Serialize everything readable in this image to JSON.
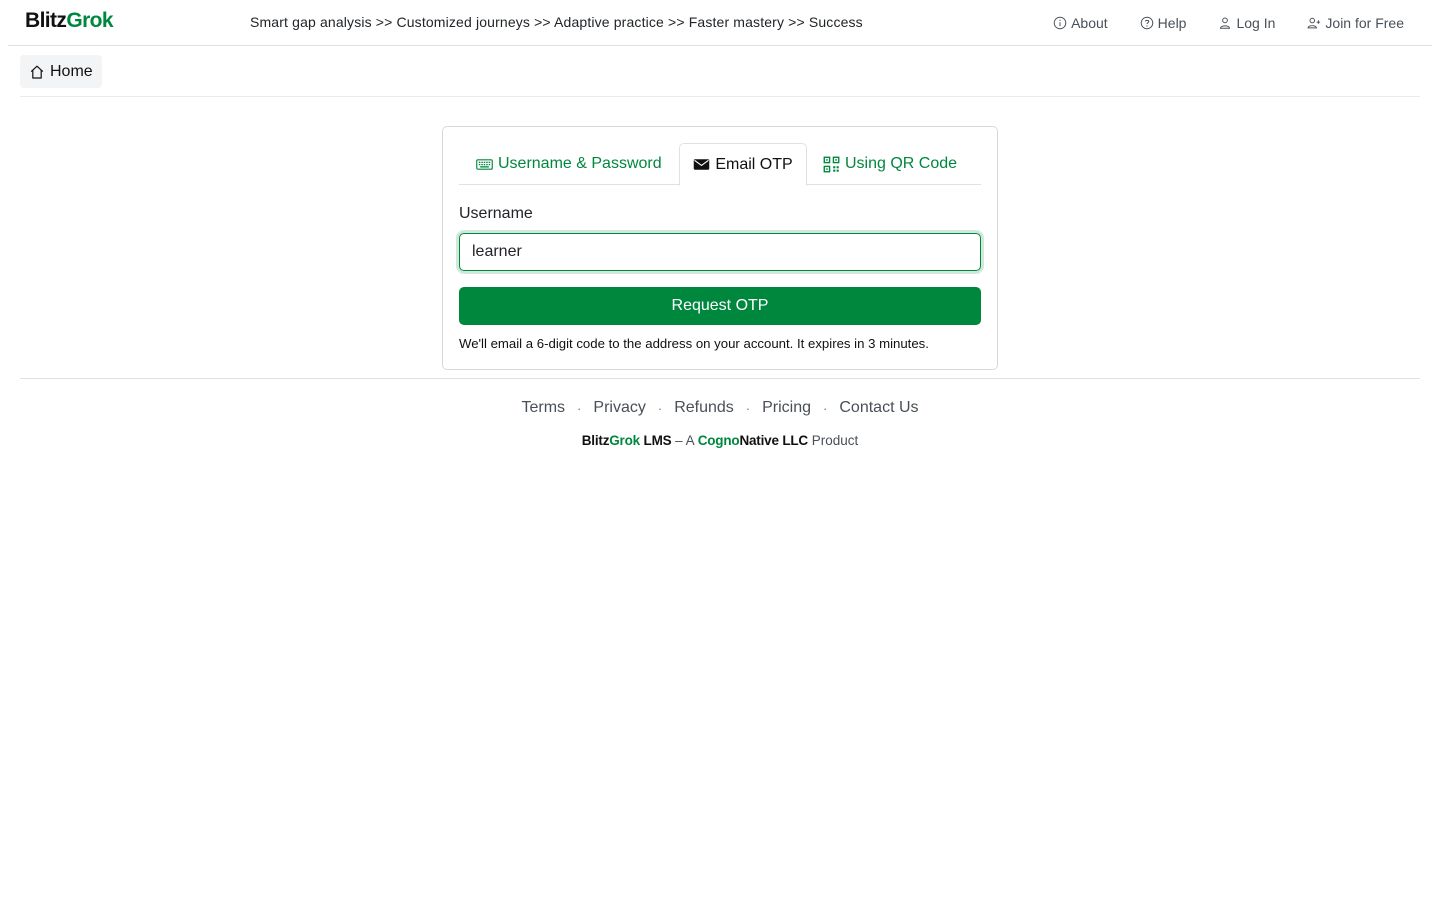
{
  "header": {
    "brand_part1": "Blitz",
    "brand_part2": "Grok",
    "tagline": "Smart gap analysis >> Customized journeys >> Adaptive practice >> Faster mastery >> Success",
    "nav": {
      "about": "About",
      "help": "Help",
      "login": "Log In",
      "join": "Join for Free"
    }
  },
  "subnav": {
    "home": "Home"
  },
  "login_card": {
    "tabs": {
      "userpass": "Username & Password",
      "email_otp": "Email OTP",
      "qr": "Using QR Code"
    },
    "active_tab": "Email OTP",
    "username_label": "Username",
    "username_value": "learner",
    "request_button": "Request OTP",
    "hint": "We'll email a 6-digit code to the address on your account. It expires in 3 minutes."
  },
  "footer": {
    "links": {
      "terms": "Terms",
      "privacy": "Privacy",
      "refunds": "Refunds",
      "pricing": "Pricing",
      "contact": "Contact Us"
    },
    "separator": "·",
    "copyright": {
      "p1": "Blitz",
      "p2": "Grok",
      "p3": " LMS",
      "p4": " – A ",
      "p5": "Cogno",
      "p6": "Native LLC",
      "p7": " Product"
    }
  },
  "icons": {
    "about": "info-circle-icon",
    "help": "question-circle-icon",
    "login": "person-icon",
    "join": "person-plus-icon",
    "home": "house-icon",
    "userpass": "keyboard-icon",
    "email_otp": "envelope-icon",
    "qr": "qr-code-icon"
  },
  "colors": {
    "brand_green": "#00873e",
    "text_dark": "#212529",
    "muted": "#495057"
  }
}
